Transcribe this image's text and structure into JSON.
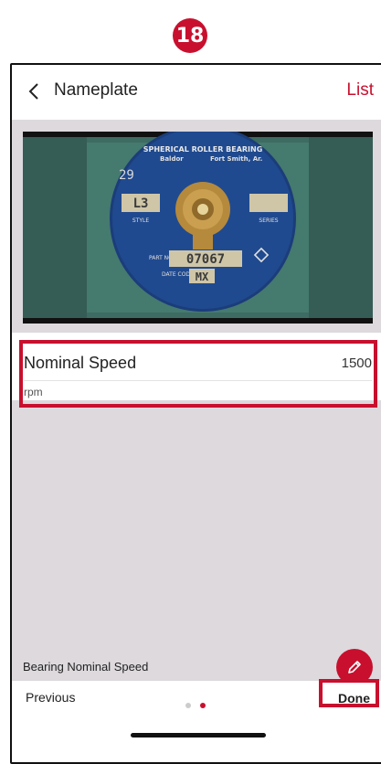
{
  "step": {
    "number": "18"
  },
  "header": {
    "back_icon": "chevron-left-icon",
    "title": "Nameplate",
    "list_label": "List"
  },
  "photo": {
    "plate_line1": "SPHERICAL ROLLER BEARING",
    "plate_line2": "Baldor",
    "plate_line3": "Fort Smith, Ar.",
    "style_value": "L3",
    "series_label": "SERIES",
    "style_label": "STYLE",
    "part_no": "07067",
    "date_code": "MX",
    "part_prefix": "PART NO.",
    "date_prefix": "DATE CODE"
  },
  "field": {
    "label": "Nominal Speed",
    "value": "1500",
    "unit": "rpm"
  },
  "description": "Bearing Nominal Speed",
  "fab": {
    "icon": "pencil-icon"
  },
  "footer": {
    "previous_label": "Previous",
    "done_label": "Done",
    "page_count": 2,
    "active_page": 2
  },
  "colors": {
    "accent": "#c8102e",
    "content_bg": "#ddd9dd",
    "dot_inactive": "#cccccc"
  }
}
